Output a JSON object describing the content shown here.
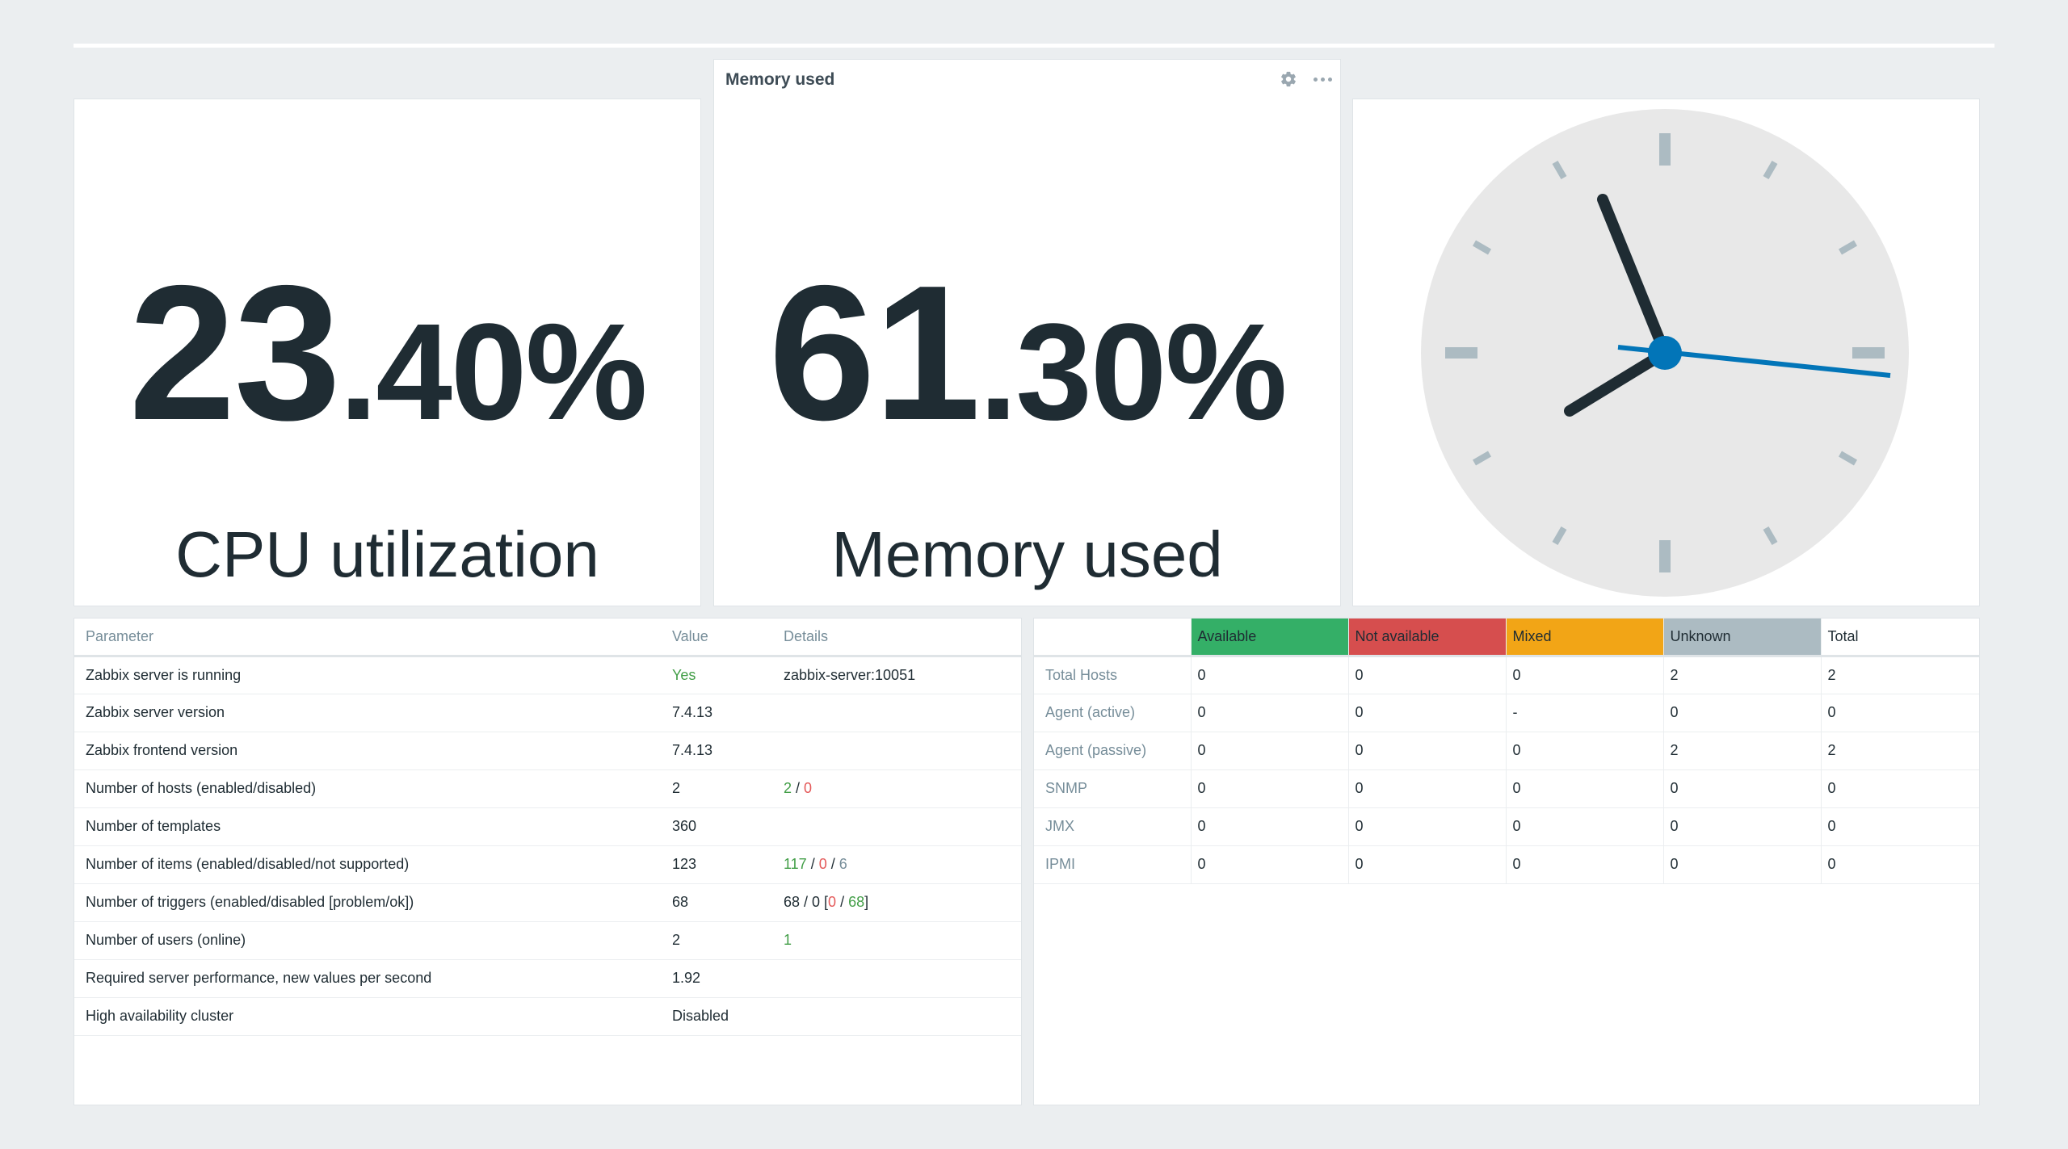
{
  "cpu_widget": {
    "int": "23",
    "dec": ".40",
    "units": "%",
    "description": "CPU utilization"
  },
  "memory_widget": {
    "header_title": "Memory used",
    "int": "61",
    "dec": ".30",
    "units": "%",
    "description": "Memory used"
  },
  "clock_widget": {
    "hour_hand_icon": "clock-hour-hand",
    "minute_hand_icon": "clock-minute-hand",
    "second_hand_icon": "clock-second-hand",
    "accent_color": "#0275b8"
  },
  "system_info": {
    "columns": [
      "Parameter",
      "Value",
      "Details"
    ],
    "rows": [
      {
        "parameter": "Zabbix server is running",
        "value": "Yes",
        "details": "zabbix-server:10051"
      },
      {
        "parameter": "Zabbix server version",
        "value": "7.4.13",
        "details": ""
      },
      {
        "parameter": "Zabbix frontend version",
        "value": "7.4.13",
        "details": ""
      },
      {
        "parameter": "Number of hosts (enabled/disabled)",
        "value": "2",
        "details_enabled": "2",
        "sep1": " / ",
        "details_disabled": "0"
      },
      {
        "parameter": "Number of templates",
        "value": "360",
        "details": ""
      },
      {
        "parameter": "Number of items (enabled/disabled/not supported)",
        "value": "123",
        "details_enabled": "117",
        "sep1": " / ",
        "details_disabled": "0",
        "sep2": " / ",
        "details_notsupported": "6"
      },
      {
        "parameter": "Number of triggers (enabled/disabled [problem/ok])",
        "value": "68",
        "details_prefix": "68 / 0 [",
        "details_problem": "0",
        "sep1": " / ",
        "details_ok": "68",
        "details_suffix": "]"
      },
      {
        "parameter": "Number of users (online)",
        "value": "2",
        "details_online": "1"
      },
      {
        "parameter": "Required server performance, new values per second",
        "value": "1.92",
        "details": ""
      },
      {
        "parameter": "High availability cluster",
        "value": "Disabled",
        "details": ""
      }
    ]
  },
  "host_availability": {
    "columns": [
      "",
      "Available",
      "Not available",
      "Mixed",
      "Unknown",
      "Total"
    ],
    "colors": {
      "available": "#34af67",
      "not_available": "#d64e4e",
      "mixed": "#f2a516",
      "unknown": "#acbbc2"
    },
    "rows": [
      {
        "label": "Total Hosts",
        "available": "0",
        "not_available": "0",
        "mixed": "0",
        "unknown": "2",
        "total": "2"
      },
      {
        "label": "Agent (active)",
        "available": "0",
        "not_available": "0",
        "mixed": "-",
        "unknown": "0",
        "total": "0"
      },
      {
        "label": "Agent (passive)",
        "available": "0",
        "not_available": "0",
        "mixed": "0",
        "unknown": "2",
        "total": "2"
      },
      {
        "label": "SNMP",
        "available": "0",
        "not_available": "0",
        "mixed": "0",
        "unknown": "0",
        "total": "0"
      },
      {
        "label": "JMX",
        "available": "0",
        "not_available": "0",
        "mixed": "0",
        "unknown": "0",
        "total": "0"
      },
      {
        "label": "IPMI",
        "available": "0",
        "not_available": "0",
        "mixed": "0",
        "unknown": "0",
        "total": "0"
      }
    ]
  }
}
